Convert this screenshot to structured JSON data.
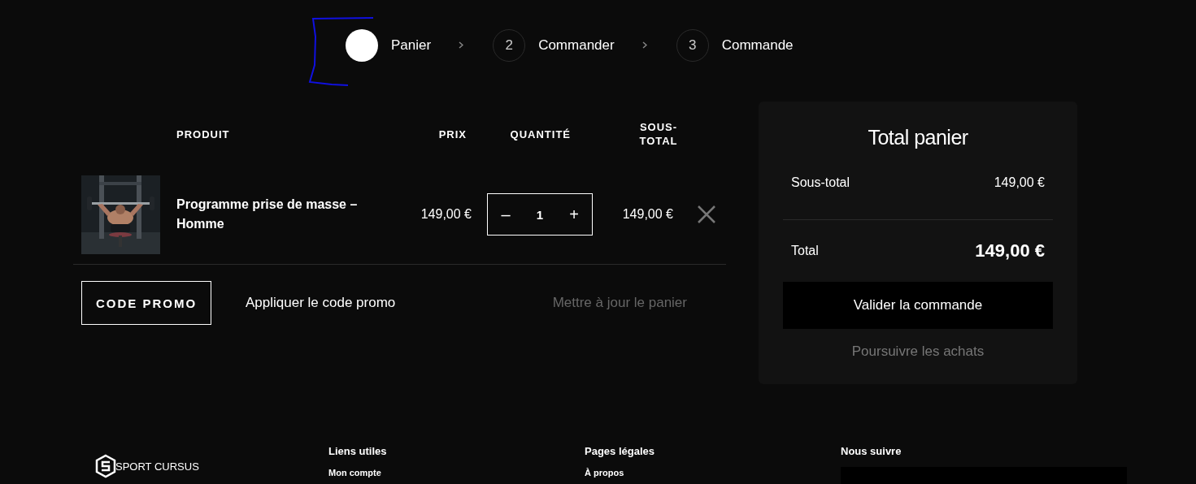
{
  "steps": [
    {
      "label": "Panier",
      "selected": true
    },
    {
      "number": "2",
      "label": "Commander",
      "selected": false
    },
    {
      "number": "3",
      "label": "Commande",
      "selected": false
    }
  ],
  "cart": {
    "columns": [
      "PRODUIT",
      "PRIX",
      "QUANTITÉ",
      "SOUS-TOTAL"
    ],
    "rows": [
      {
        "product": "Programme prise de masse – Homme",
        "price": "149,00 €",
        "quantity": {
          "minus": "–",
          "value": "1",
          "plus": "+"
        },
        "subtotal": "149,00 €"
      }
    ],
    "coupon_button": "CODE PROMO",
    "apply_link": "Appliquer le code promo",
    "update_button": {
      "label": "Mettre à jour le panier",
      "disabled": true
    }
  },
  "totals": {
    "title": "Total panier",
    "rows": [
      {
        "label": "Sous-total",
        "value": "149,00 €",
        "kind": "subtotal"
      },
      {
        "label": "Total",
        "value": "149,00 €",
        "kind": "total"
      }
    ],
    "checkout_button": "Valider la commande",
    "continue_link": "Poursuivre les achats"
  },
  "footer": {
    "logo": "SPORT CURSUS",
    "columns": [
      {
        "title": "Liens utiles",
        "links": [
          "Mon compte"
        ]
      },
      {
        "title": "Pages légales",
        "links": [
          "À propos"
        ]
      },
      {
        "title": "Nous suivre"
      }
    ]
  }
}
